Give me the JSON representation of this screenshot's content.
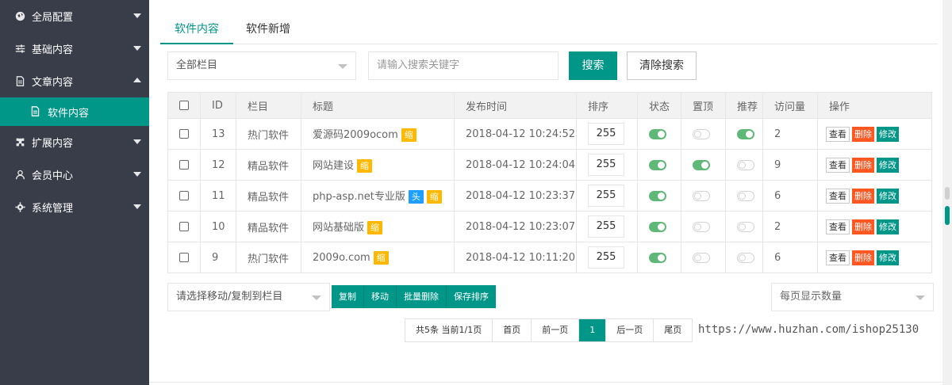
{
  "sidebar": {
    "items": [
      {
        "label": "全局配置",
        "icon": "globe-icon",
        "arrow": "down"
      },
      {
        "label": "基础内容",
        "icon": "sliders-icon",
        "arrow": "down"
      },
      {
        "label": "文章内容",
        "icon": "document-icon",
        "arrow": "up"
      },
      {
        "label": "扩展内容",
        "icon": "puzzle-icon",
        "arrow": "down"
      },
      {
        "label": "会员中心",
        "icon": "user-icon",
        "arrow": "down"
      },
      {
        "label": "系统管理",
        "icon": "gear-icon",
        "arrow": "down"
      }
    ],
    "active_sub": {
      "label": "软件内容",
      "icon": "document-icon"
    }
  },
  "tabs": [
    {
      "label": "软件内容",
      "active": true
    },
    {
      "label": "软件新增",
      "active": false
    }
  ],
  "filter": {
    "category_select": "全部栏目",
    "search_placeholder": "请输入搜索关键字",
    "search_button": "搜索",
    "clear_button": "清除搜索"
  },
  "table": {
    "headers": [
      "ID",
      "栏目",
      "标题",
      "发布时间",
      "排序",
      "状态",
      "置顶",
      "推荐",
      "访问量",
      "操作"
    ],
    "rows": [
      {
        "id": "13",
        "category": "热门软件",
        "title": "爱源码2009ocom",
        "badges": [
          {
            "text": "缩",
            "color": "orange"
          }
        ],
        "time": "2018-04-12 10:24:52",
        "sort": "255",
        "status": true,
        "top": false,
        "recommend": true,
        "views": "2"
      },
      {
        "id": "12",
        "category": "精品软件",
        "title": "网站建设",
        "badges": [
          {
            "text": "缩",
            "color": "orange"
          }
        ],
        "time": "2018-04-12 10:24:04",
        "sort": "255",
        "status": true,
        "top": true,
        "recommend": false,
        "views": "9"
      },
      {
        "id": "11",
        "category": "精品软件",
        "title": "php-asp.net专业版",
        "badges": [
          {
            "text": "头",
            "color": "blue"
          },
          {
            "text": "缩",
            "color": "orange"
          }
        ],
        "time": "2018-04-12 10:23:37",
        "sort": "255",
        "status": true,
        "top": false,
        "recommend": false,
        "views": "6"
      },
      {
        "id": "10",
        "category": "精品软件",
        "title": "网站基础版",
        "badges": [
          {
            "text": "缩",
            "color": "orange"
          }
        ],
        "time": "2018-04-12 10:23:07",
        "sort": "255",
        "status": true,
        "top": false,
        "recommend": false,
        "views": "2"
      },
      {
        "id": "9",
        "category": "热门软件",
        "title": "2009o.com",
        "badges": [
          {
            "text": "缩",
            "color": "orange"
          }
        ],
        "time": "2018-04-12 10:11:20",
        "sort": "255",
        "status": true,
        "top": false,
        "recommend": false,
        "views": "6"
      }
    ],
    "actions": {
      "view": "查看",
      "delete": "删除",
      "edit": "修改"
    }
  },
  "batch": {
    "move_select": "请选择移动/复制到栏目",
    "buttons": [
      "复制",
      "移动",
      "批量删除",
      "保存排序"
    ],
    "page_size_select": "每页显示数量"
  },
  "pager": {
    "info": "共5条 当前1/1页",
    "first": "首页",
    "prev": "前一页",
    "current": "1",
    "next": "后一页",
    "last": "尾页"
  },
  "watermark": "https://www.huzhan.com/ishop25130",
  "colors": {
    "primary": "#009688",
    "sidebar": "#393d49",
    "danger": "#ff5722",
    "badge_orange": "#ffb800",
    "badge_blue": "#1e9fff",
    "switch_on": "#5fb878"
  }
}
